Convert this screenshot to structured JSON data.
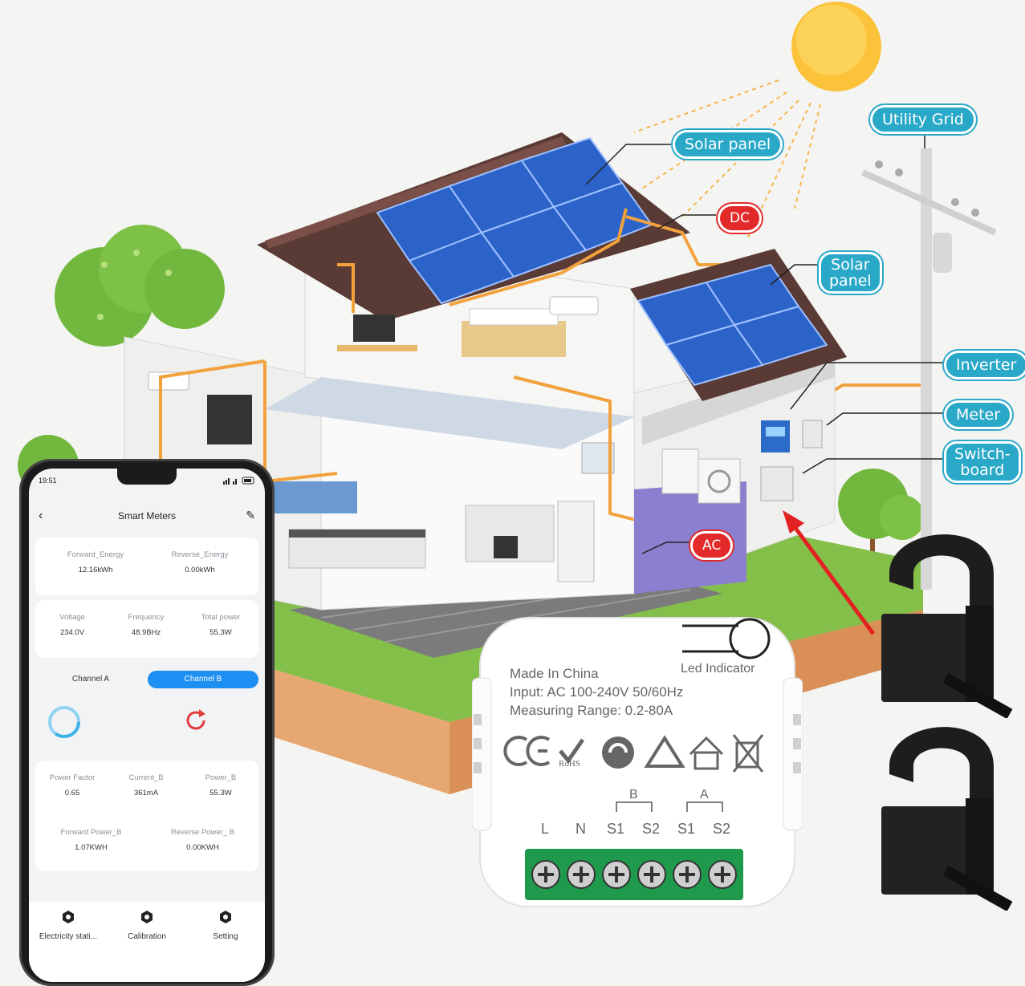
{
  "labels": {
    "solar_panel_roof": "Solar panel",
    "dc": "DC",
    "solar_panel_annex": "Solar\npanel",
    "utility_grid": "Utility Grid",
    "inverter": "Inverter",
    "meter": "Meter",
    "switchboard": "Switch-\nboard",
    "ac": "AC"
  },
  "colors": {
    "callout_blue": "#2aa8c8",
    "callout_red": "#e32a2a",
    "wire_orange": "#f2a23c",
    "app_accent": "#1e8ff2"
  },
  "app": {
    "status_time": "19:51",
    "title": "Smart Meters",
    "energy": {
      "forward_label": "Forward_Energy",
      "forward_value": "12.16kWh",
      "reverse_label": "Reverse_Energy",
      "reverse_value": "0.00kWh"
    },
    "readings": {
      "voltage_label": "Voltage",
      "voltage_value": "234.0V",
      "frequency_label": "Frequency",
      "frequency_value": "48.9BHz",
      "total_power_label": "Total power",
      "total_power_value": "55.3W"
    },
    "tabs": {
      "channel_a": "Channel A",
      "channel_b": "Channel B"
    },
    "channel_b": {
      "power_factor_label": "Power Factor",
      "power_factor_value": "0.65",
      "current_label": "Current_B",
      "current_value": "361mA",
      "power_label": "Power_B",
      "power_value": "55.3W",
      "forward_power_label": "Forward Power_B",
      "forward_power_value": "1.07KWH",
      "reverse_power_label": "Reverse Power_ B",
      "reverse_power_value": "0.00KWH"
    },
    "footer": {
      "electricity": "Electricity stati...",
      "calibration": "Calibration",
      "setting": "Setting"
    }
  },
  "device": {
    "made_in": "Made In China",
    "input": "Input: AC 100-240V 50/60Hz",
    "range": "Measuring Range: 0.2-80A",
    "led": "Led Indicator",
    "rohs": "RoHS",
    "group_b": "B",
    "group_a": "A",
    "terminals": [
      "L",
      "N",
      "S1",
      "S2",
      "S1",
      "S2"
    ]
  }
}
